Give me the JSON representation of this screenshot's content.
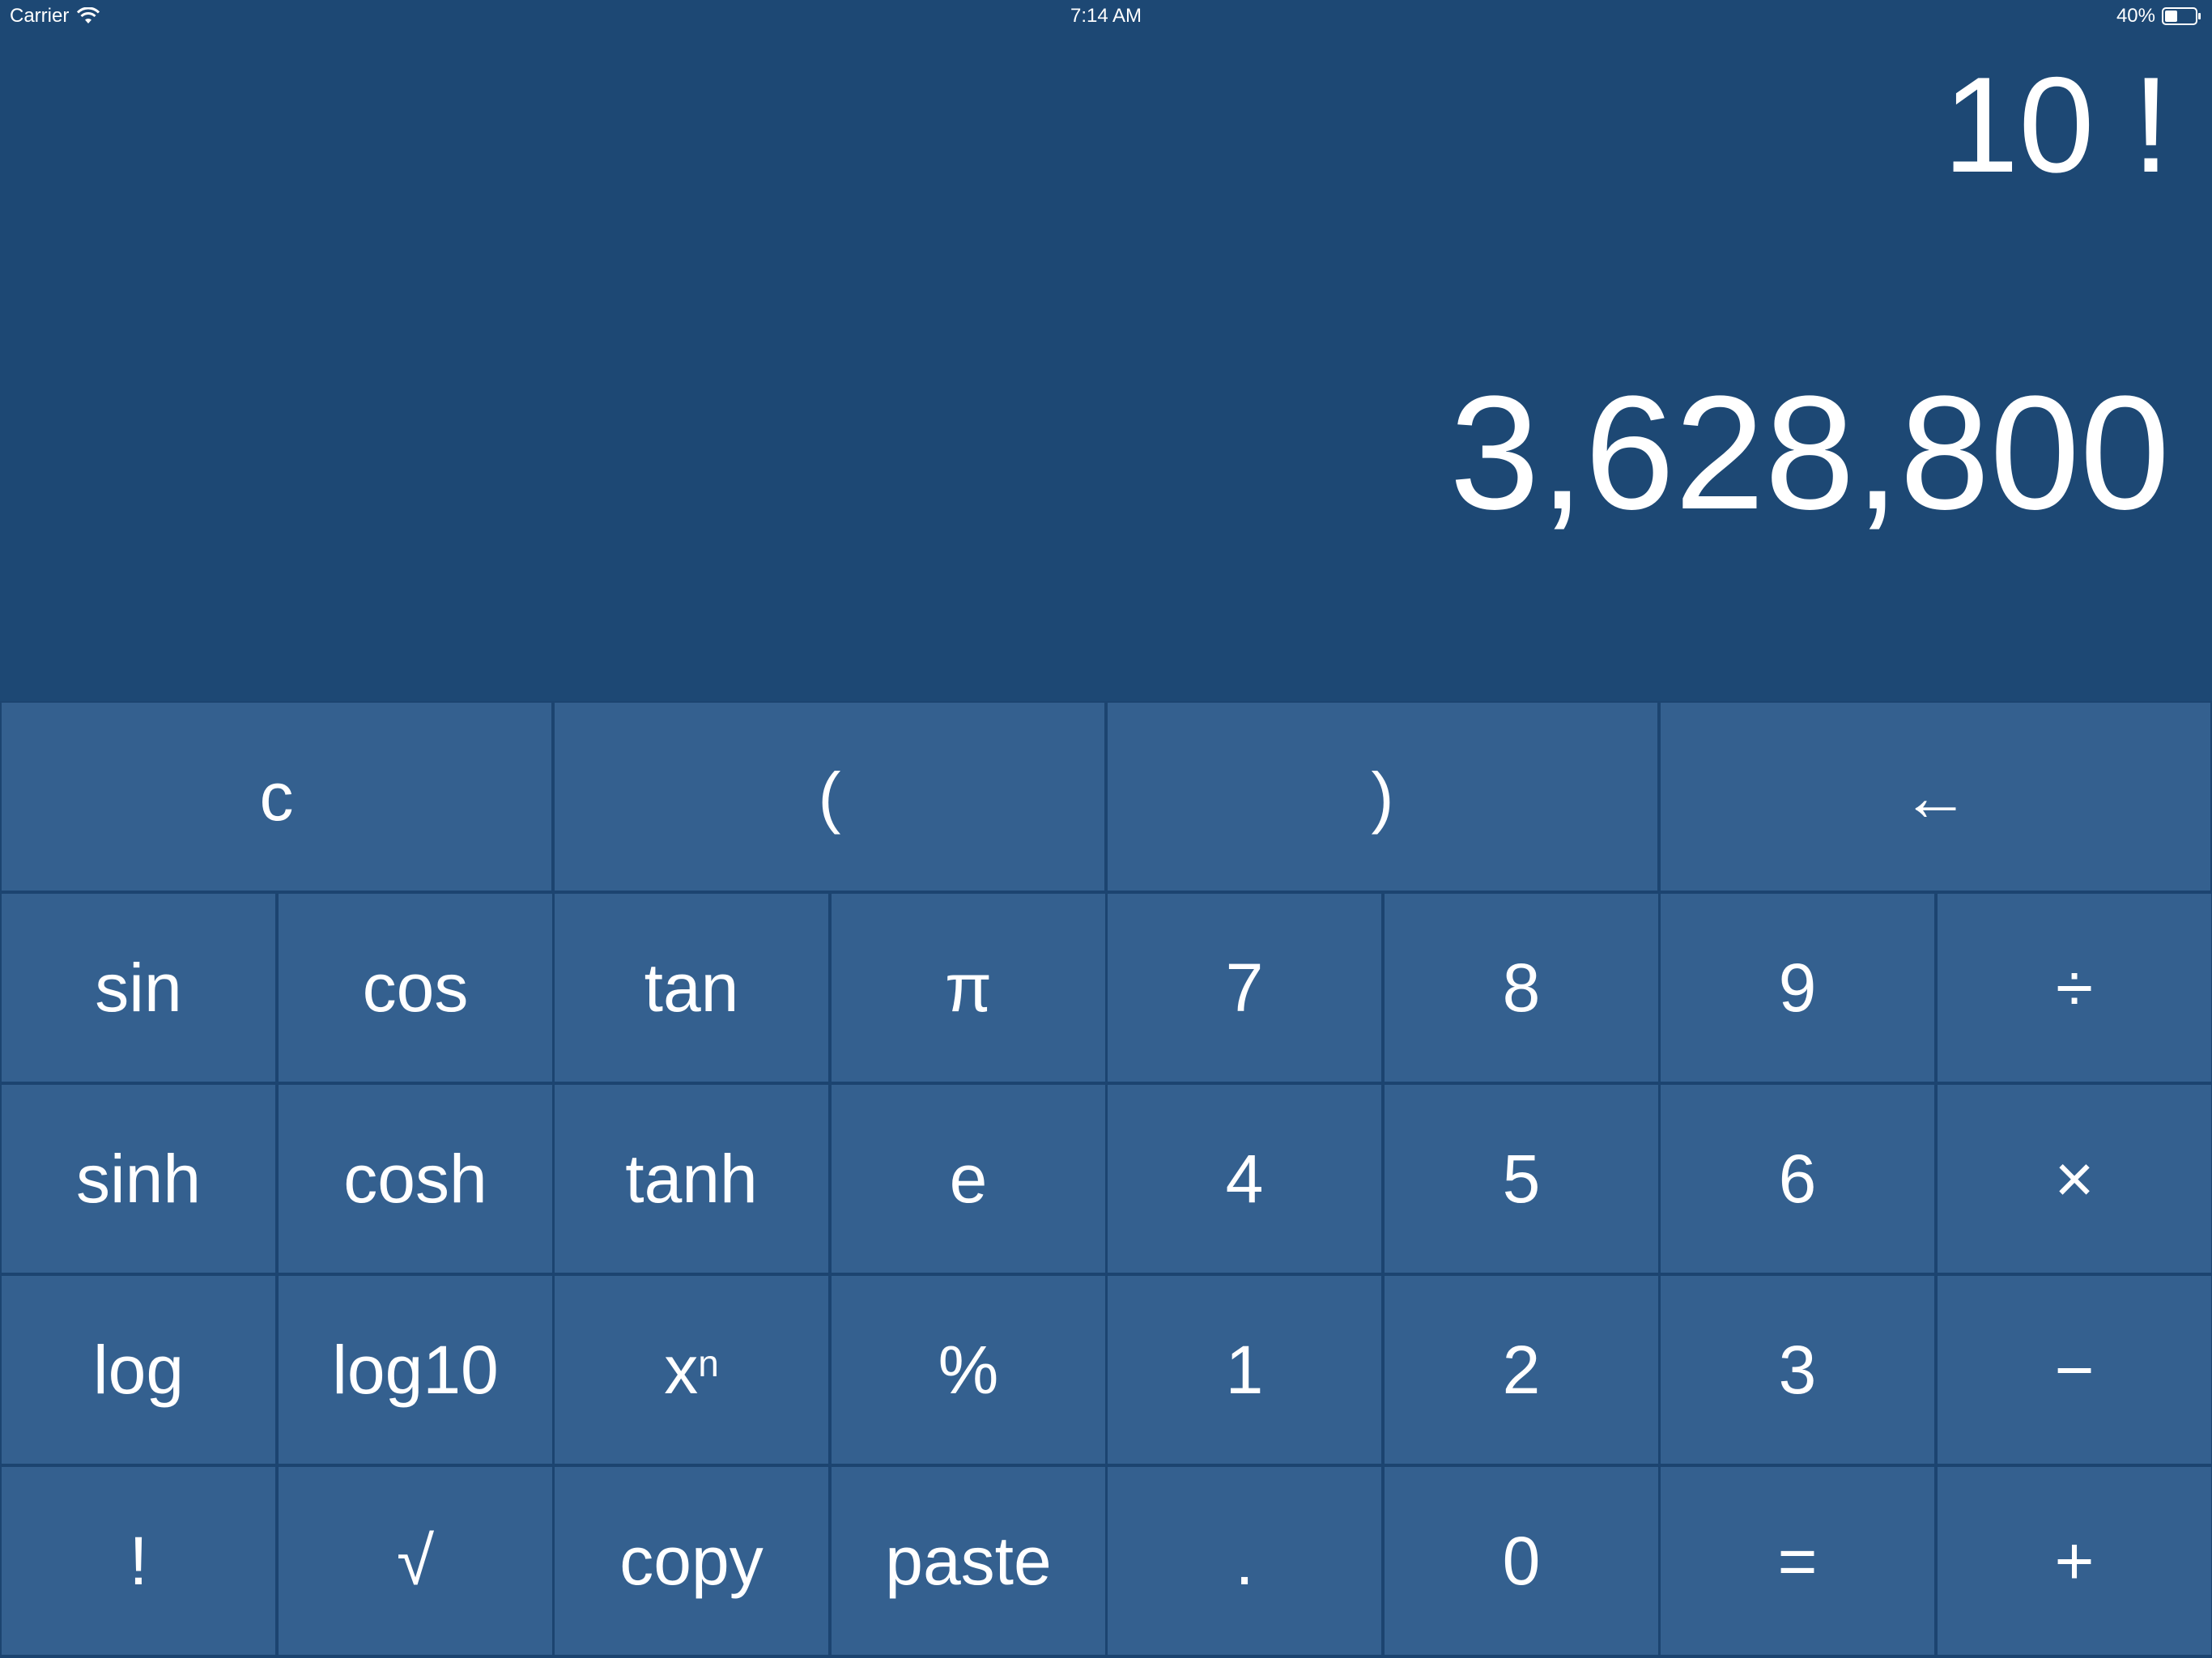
{
  "status_bar": {
    "carrier": "Carrier",
    "time": "7:14 AM",
    "battery": "40%"
  },
  "display": {
    "expression": "10 !",
    "result": "3,628,800"
  },
  "keypad": {
    "top_row": [
      {
        "label": "c",
        "name": "clear-button"
      },
      {
        "label": "(",
        "name": "open-paren-button"
      },
      {
        "label": ")",
        "name": "close-paren-button"
      },
      {
        "label": "←",
        "name": "backspace-button"
      }
    ],
    "rows": [
      [
        {
          "label": "sin",
          "name": "sin-button"
        },
        {
          "label": "cos",
          "name": "cos-button"
        },
        {
          "label": "tan",
          "name": "tan-button"
        },
        {
          "label": "π",
          "name": "pi-button"
        },
        {
          "label": "7",
          "name": "digit-7-button"
        },
        {
          "label": "8",
          "name": "digit-8-button"
        },
        {
          "label": "9",
          "name": "digit-9-button"
        },
        {
          "label": "÷",
          "name": "divide-button"
        }
      ],
      [
        {
          "label": "sinh",
          "name": "sinh-button"
        },
        {
          "label": "cosh",
          "name": "cosh-button"
        },
        {
          "label": "tanh",
          "name": "tanh-button"
        },
        {
          "label": "e",
          "name": "euler-button"
        },
        {
          "label": "4",
          "name": "digit-4-button"
        },
        {
          "label": "5",
          "name": "digit-5-button"
        },
        {
          "label": "6",
          "name": "digit-6-button"
        },
        {
          "label": "×",
          "name": "multiply-button"
        }
      ],
      [
        {
          "label": "log",
          "name": "log-button"
        },
        {
          "label": "log10",
          "name": "log10-button"
        },
        {
          "label": "x",
          "sup": "n",
          "name": "power-button"
        },
        {
          "label": "%",
          "name": "percent-button"
        },
        {
          "label": "1",
          "name": "digit-1-button"
        },
        {
          "label": "2",
          "name": "digit-2-button"
        },
        {
          "label": "3",
          "name": "digit-3-button"
        },
        {
          "label": "−",
          "name": "subtract-button"
        }
      ],
      [
        {
          "label": "!",
          "name": "factorial-button"
        },
        {
          "label": "√",
          "name": "sqrt-button"
        },
        {
          "label": "copy",
          "name": "copy-button"
        },
        {
          "label": "paste",
          "name": "paste-button"
        },
        {
          "label": ".",
          "name": "decimal-button"
        },
        {
          "label": "0",
          "name": "digit-0-button"
        },
        {
          "label": "=",
          "name": "equals-button"
        },
        {
          "label": "+",
          "name": "add-button"
        }
      ]
    ]
  }
}
